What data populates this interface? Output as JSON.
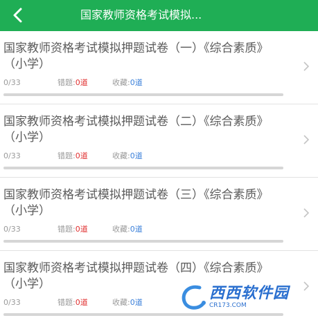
{
  "header": {
    "title": "国家教师资格考试模拟...",
    "back_icon": "back-arrow-icon",
    "color": "#1fae55"
  },
  "labels": {
    "wrong": "错题:",
    "favorite": "收藏:"
  },
  "items": [
    {
      "title": "国家教师资格考试模拟押题试卷（一）《综合素质》（小学）",
      "progress": "0/33",
      "progress_fraction": 0,
      "wrong": "0道",
      "favorite": "0道"
    },
    {
      "title": "国家教师资格考试模拟押题试卷（二）《综合素质》（小学）",
      "progress": "0/33",
      "progress_fraction": 0,
      "wrong": "0道",
      "favorite": "0道"
    },
    {
      "title": "国家教师资格考试模拟押题试卷（三）《综合素质》（小学）",
      "progress": "0/33",
      "progress_fraction": 0,
      "wrong": "0道",
      "favorite": "0道"
    },
    {
      "title": "国家教师资格考试模拟押题试卷（四）《综合素质》（小学）",
      "progress": "0/33",
      "progress_fraction": 0,
      "wrong": "0道",
      "favorite": "0道"
    }
  ],
  "watermark": {
    "text": "西西软件园",
    "subtext": "CR173.COM"
  }
}
